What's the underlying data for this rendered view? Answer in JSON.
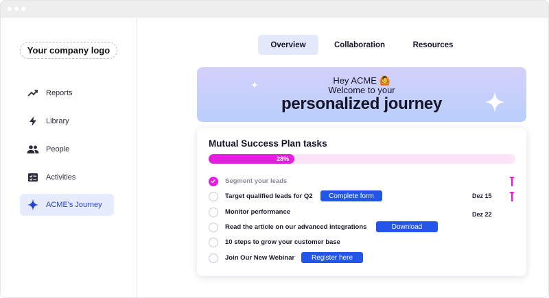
{
  "sidebar": {
    "logo_text": "Your company logo",
    "items": [
      {
        "label": "Reports",
        "icon": "trend-up-icon"
      },
      {
        "label": "Library",
        "icon": "lightning-icon"
      },
      {
        "label": "People",
        "icon": "people-icon"
      },
      {
        "label": "Activities",
        "icon": "checklist-icon"
      },
      {
        "label": "ACME's Journey",
        "icon": "sparkle-icon",
        "active": true
      }
    ]
  },
  "tabs": [
    {
      "label": "Overview",
      "active": true
    },
    {
      "label": "Collaboration"
    },
    {
      "label": "Resources"
    }
  ],
  "banner": {
    "line1": "Hey ACME 🙆",
    "line2": "Welcome to your",
    "headline": "personalized journey"
  },
  "plan": {
    "title": "Mutual Success Plan tasks",
    "progress_label": "28%",
    "progress_value": 0.28,
    "tasks": [
      {
        "label": "Segment your leads",
        "done": true
      },
      {
        "label": "Target qualified leads for Q2",
        "button": "Complete form",
        "date": "Dez 15"
      },
      {
        "label": "Monitor performance",
        "date": "Dez 22"
      },
      {
        "label": "Read the article on our advanced integrations",
        "button": "Download"
      },
      {
        "label": "10 steps to grow your customer base"
      },
      {
        "label": "Join Our New Webinar",
        "button": "Register here"
      }
    ]
  },
  "colors": {
    "accent_magenta": "#e51fe0",
    "button_blue": "#2255e8",
    "active_nav_bg": "#e6ebfd"
  }
}
